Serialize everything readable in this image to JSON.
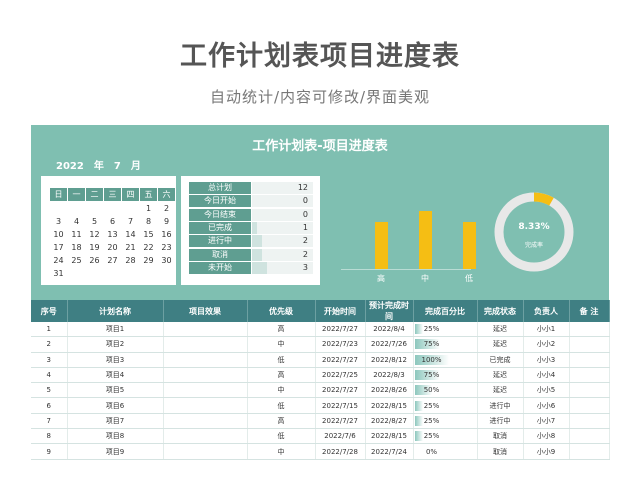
{
  "page": {
    "title": "工作计划表项目进度表",
    "subtitle": "自动统计/内容可修改/界面美观"
  },
  "sheet": {
    "title": "工作计划表-项目进度表",
    "year": "2022",
    "year_unit": "年",
    "month": "7",
    "month_unit": "月"
  },
  "calendar": {
    "weekdays": [
      "日",
      "一",
      "二",
      "三",
      "四",
      "五",
      "六"
    ],
    "weeks": [
      [
        "",
        "",
        "",
        "",
        "",
        "1",
        "2"
      ],
      [
        "3",
        "4",
        "5",
        "6",
        "7",
        "8",
        "9"
      ],
      [
        "10",
        "11",
        "12",
        "13",
        "14",
        "15",
        "16"
      ],
      [
        "17",
        "18",
        "19",
        "20",
        "21",
        "22",
        "23"
      ],
      [
        "24",
        "25",
        "26",
        "27",
        "28",
        "29",
        "30"
      ],
      [
        "31",
        "",
        "",
        "",
        "",
        "",
        ""
      ]
    ]
  },
  "stats": [
    {
      "label": "总计划",
      "value": 12
    },
    {
      "label": "今日开始",
      "value": 0
    },
    {
      "label": "今日结束",
      "value": 0
    },
    {
      "label": "已完成",
      "value": 1
    },
    {
      "label": "进行中",
      "value": 2
    },
    {
      "label": "取消",
      "value": 2
    },
    {
      "label": "未开始",
      "value": 3
    }
  ],
  "chart_data": [
    {
      "type": "bar",
      "categories": [
        "高",
        "中",
        "低"
      ],
      "values": [
        4,
        5,
        4
      ],
      "color": "#f5be14"
    },
    {
      "type": "pie",
      "label": "完成率",
      "value_text": "8.33%",
      "value": 0.0833,
      "colors": {
        "done": "#f5be14",
        "rest": "#e8e8e8"
      }
    }
  ],
  "table": {
    "headers": [
      "序号",
      "计划名称",
      "项目效果",
      "优先级",
      "开始时间",
      "预计完成时间",
      "完成百分比",
      "完成状态",
      "负责人",
      "备 注"
    ],
    "rows": [
      {
        "no": "1",
        "name": "项目1",
        "effect": "",
        "priority": "高",
        "start": "2022/7/27",
        "end": "2022/8/4",
        "pct": "25%",
        "pct_value": 0.25,
        "status": "延迟",
        "owner": "小小1",
        "note": ""
      },
      {
        "no": "2",
        "name": "项目2",
        "effect": "",
        "priority": "中",
        "start": "2022/7/23",
        "end": "2022/7/26",
        "pct": "75%",
        "pct_value": 0.75,
        "status": "延迟",
        "owner": "小小2",
        "note": ""
      },
      {
        "no": "3",
        "name": "项目3",
        "effect": "",
        "priority": "低",
        "start": "2022/7/27",
        "end": "2022/8/12",
        "pct": "100%",
        "pct_value": 1.0,
        "status": "已完成",
        "owner": "小小3",
        "note": ""
      },
      {
        "no": "4",
        "name": "项目4",
        "effect": "",
        "priority": "高",
        "start": "2022/7/25",
        "end": "2022/8/3",
        "pct": "75%",
        "pct_value": 0.75,
        "status": "延迟",
        "owner": "小小4",
        "note": ""
      },
      {
        "no": "5",
        "name": "项目5",
        "effect": "",
        "priority": "中",
        "start": "2022/7/27",
        "end": "2022/8/26",
        "pct": "50%",
        "pct_value": 0.5,
        "status": "延迟",
        "owner": "小小5",
        "note": ""
      },
      {
        "no": "6",
        "name": "项目6",
        "effect": "",
        "priority": "低",
        "start": "2022/7/15",
        "end": "2022/8/15",
        "pct": "25%",
        "pct_value": 0.25,
        "status": "进行中",
        "owner": "小小6",
        "note": ""
      },
      {
        "no": "7",
        "name": "项目7",
        "effect": "",
        "priority": "高",
        "start": "2022/7/27",
        "end": "2022/8/27",
        "pct": "25%",
        "pct_value": 0.25,
        "status": "进行中",
        "owner": "小小7",
        "note": ""
      },
      {
        "no": "8",
        "name": "项目8",
        "effect": "",
        "priority": "低",
        "start": "2022/7/6",
        "end": "2022/8/15",
        "pct": "25%",
        "pct_value": 0.25,
        "status": "取消",
        "owner": "小小8",
        "note": ""
      },
      {
        "no": "9",
        "name": "项目9",
        "effect": "",
        "priority": "中",
        "start": "2022/7/28",
        "end": "2022/7/24",
        "pct": "0%",
        "pct_value": 0.0,
        "status": "取消",
        "owner": "小小9",
        "note": ""
      }
    ]
  }
}
